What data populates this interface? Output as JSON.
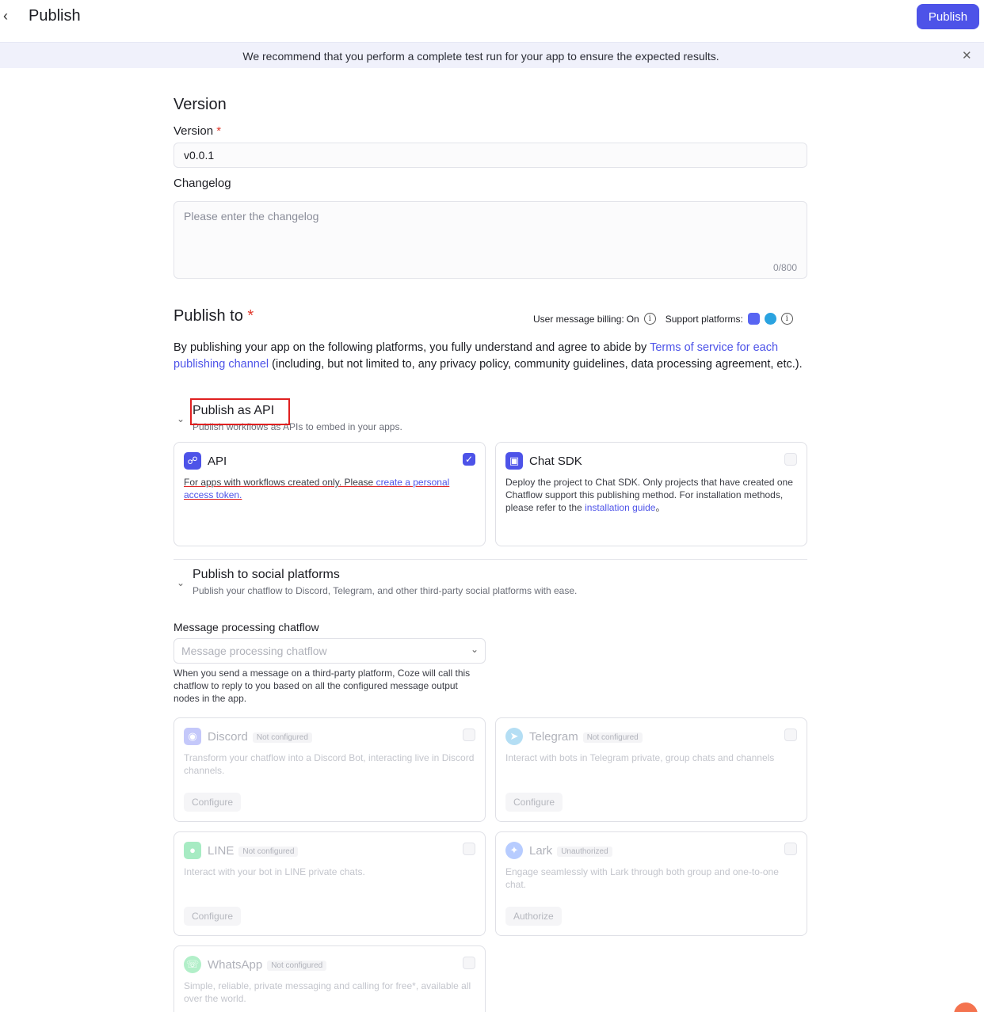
{
  "header": {
    "title": "Publish",
    "publish_label": "Publish"
  },
  "banner": {
    "text": "We recommend that you perform a complete test run for your app to ensure the expected results."
  },
  "version_section": {
    "heading": "Version",
    "version_label": "Version",
    "required_mark": "*",
    "version_value": "v0.0.1",
    "changelog_label": "Changelog",
    "changelog_placeholder": "Please enter the changelog",
    "changelog_counter": "0/800"
  },
  "publish_to": {
    "heading": "Publish to",
    "required_mark": "*",
    "billing_label": "User message billing:",
    "billing_value": "On",
    "support_label": "Support platforms:",
    "support_icons": [
      "discord-icon",
      "telegram-icon"
    ],
    "terms_pre": "By publishing your app on the following platforms, you fully understand and agree to abide by ",
    "terms_link": "Terms of service for each publishing channel",
    "terms_post": " (including, but not limited to, any privacy policy, community guidelines, data processing agreement, etc.)."
  },
  "api_group": {
    "title": "Publish as API",
    "subtitle": "Publish workflows as APIs to embed in your apps.",
    "cards": {
      "api": {
        "title": "API",
        "checked": true,
        "desc_pre": "For apps with workflows created only. Please ",
        "desc_link": "create a personal access token.",
        "icon": "link-icon",
        "color": "#4d53e8"
      },
      "chat_sdk": {
        "title": "Chat SDK",
        "checked": false,
        "desc_pre": "Deploy the project to Chat SDK. Only projects that have created one Chatflow support this publishing method. For installation methods, please refer to the ",
        "desc_link": "installation guide",
        "desc_post": "。",
        "icon": "window-icon",
        "color": "#4d53e8"
      }
    }
  },
  "social_group": {
    "title": "Publish to social platforms",
    "subtitle": "Publish your chatflow to Discord, Telegram, and other third-party social platforms with ease.",
    "chatflow_label": "Message processing chatflow",
    "chatflow_placeholder": "Message processing chatflow",
    "chatflow_help": "When you send a message on a third-party platform, Coze will call this chatflow to reply to you based on all the configured message output nodes in the app.",
    "cards": {
      "discord": {
        "title": "Discord",
        "badge": "Not configured",
        "desc": "Transform your chatflow into a Discord Bot, interacting live in Discord channels.",
        "button": "Configure",
        "color": "#5865f2"
      },
      "telegram": {
        "title": "Telegram",
        "badge": "Not configured",
        "desc": "Interact with bots in Telegram private, group chats and channels",
        "button": "Configure",
        "color": "#2aa3e0"
      },
      "line": {
        "title": "LINE",
        "badge": "Not configured",
        "desc": "Interact with your bot in LINE private chats.",
        "button": "Configure",
        "color": "#06c755"
      },
      "lark": {
        "title": "Lark",
        "badge": "Unauthorized",
        "desc": "Engage seamlessly with Lark through both group and one-to-one chat.",
        "button": "Authorize",
        "color": "#3370ff"
      },
      "whatsapp": {
        "title": "WhatsApp",
        "badge": "Not configured",
        "desc": "Simple, reliable, private messaging and calling for free*, available all over the world.",
        "color": "#25d366"
      }
    }
  }
}
